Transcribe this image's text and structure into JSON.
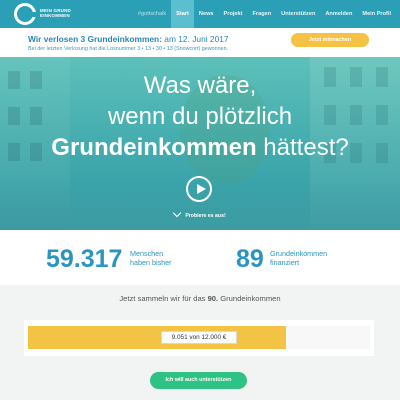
{
  "logo": {
    "line1": "MEIN GRUND",
    "line2": "EINKOMMEN"
  },
  "nav": {
    "hashtag": "#gottschalk",
    "items": [
      "Start",
      "News",
      "Projekt",
      "Fragen",
      "Unterstützen",
      "Anmelden",
      "Mein Profil"
    ],
    "active": "Start"
  },
  "announcement": {
    "title_bold": "Wir verlosen 3 Grundeinkommen:",
    "title_rest": " am 12. Juni 2017",
    "subtitle": "Bei der letzten Verlosung hat die Losnummer 3 • 13 • 30 • 13 (Snowcort) gewonnen.",
    "button": "Jetzt mitmachen"
  },
  "hero": {
    "line1": "Was wäre,",
    "line2": "wenn du plötzlich",
    "line3_bold": "Grundeinkommen",
    "line3_rest": " hättest?",
    "try_link": "Probiere es aus!"
  },
  "stats": {
    "people_count": "59.317",
    "people_label1": "Menschen",
    "people_label2": "haben bisher",
    "income_count": "89",
    "income_label1": "Grundeinkommen",
    "income_label2": "finanziert"
  },
  "campaign": {
    "collect_prefix": "Jetzt sammeln wir für das ",
    "collect_number": "90.",
    "collect_suffix": " Grundeinkommen",
    "progress_text": "9.051 von 12.000 €",
    "progress_fraction": 0.754,
    "support_button": "Ich will auch unterstützen"
  },
  "colors": {
    "nav": "#2b9fb6",
    "accent_yellow": "#f3c343",
    "accent_green": "#2fc285",
    "stat_blue": "#2a95c0"
  }
}
